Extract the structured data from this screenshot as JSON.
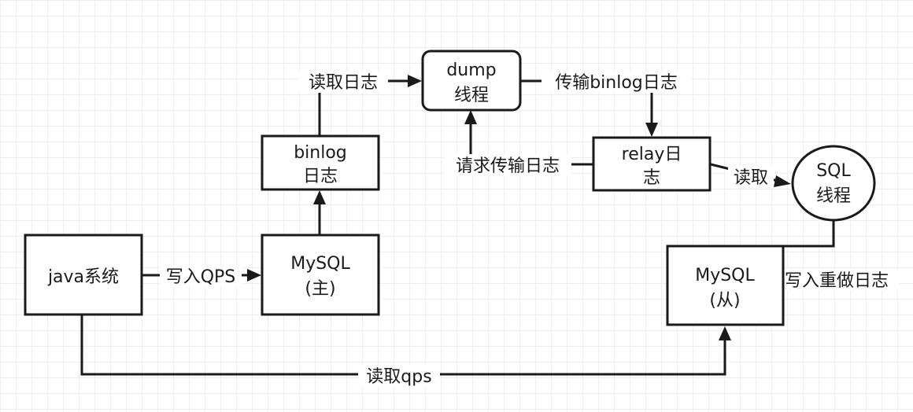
{
  "nodes": {
    "java": "java系统",
    "master_l1": "MySQL",
    "master_l2": "(主)",
    "binlog_l1": "binlog",
    "binlog_l2": "日志",
    "dump_l1": "dump",
    "dump_l2": "线程",
    "relay_l1": "relay日",
    "relay_l2": "志",
    "sql_l1": "SQL",
    "sql_l2": "线程",
    "slave_l1": "MySQL",
    "slave_l2": "(从)"
  },
  "edges": {
    "write_qps": "写入QPS",
    "read_log": "读取日志",
    "transfer_binlog": "传输binlog日志",
    "request_transfer": "请求传输日志",
    "read": "读取",
    "write_redo": "写入重做日志",
    "read_qps": "读取qps"
  }
}
